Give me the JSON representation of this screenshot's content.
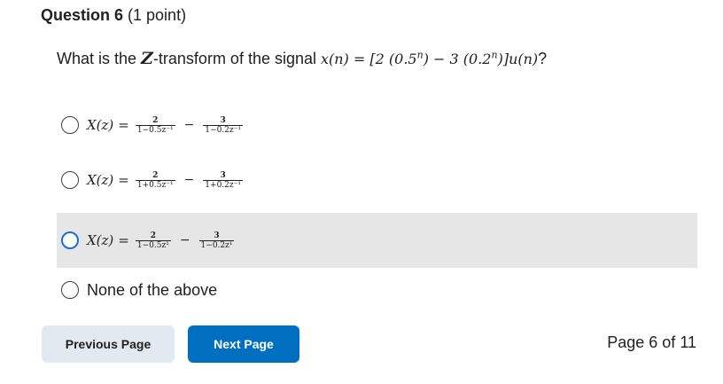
{
  "question": {
    "title": "Question 6",
    "points": "(1 point)",
    "prompt_prefix": "What is the ",
    "transform_symbol": "Z",
    "prompt_middle": "-transform of the signal ",
    "signal_expr_html": "x(n) = [2 (0.5<sup>n</sup>) − 3 (0.2<sup>n</sup>)]u(n)",
    "prompt_suffix": "?"
  },
  "options": [
    {
      "lhs": "X(z)",
      "eq": "=",
      "num1": "2",
      "den1": "1−0.5z⁻¹",
      "op": "−",
      "num2": "3",
      "den2": "1−0.2z⁻¹"
    },
    {
      "lhs": "X(z)",
      "eq": "=",
      "num1": "2",
      "den1": "1+0.5z⁻¹",
      "op": "−",
      "num2": "3",
      "den2": "1+0.2z⁻¹"
    },
    {
      "lhs": "X(z)",
      "eq": "=",
      "num1": "2",
      "den1": "1−0.5z¹",
      "op": "−",
      "num2": "3",
      "den2": "1−0.2z¹"
    },
    {
      "label": "None of the above"
    }
  ],
  "nav": {
    "prev_label": "Previous Page",
    "next_label": "Next Page",
    "page_indicator": "Page 6 of 11"
  },
  "colors": {
    "next_button": "#006fbf",
    "prev_button": "#e3e9f1",
    "hover_row": "#e6e6e6",
    "radio_focus": "#1a6fd3"
  }
}
